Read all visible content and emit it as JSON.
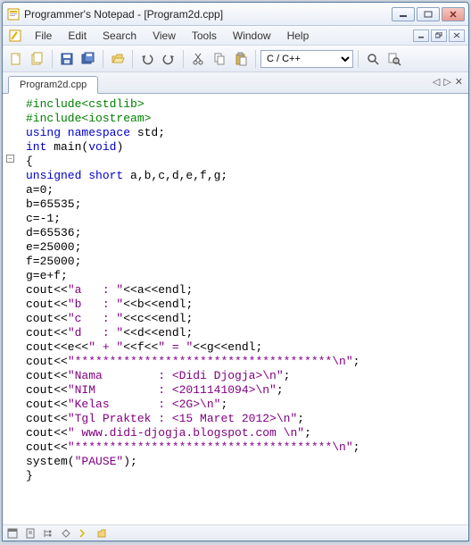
{
  "window": {
    "title": "Programmer's Notepad - [Program2d.cpp]"
  },
  "menu": {
    "file": "File",
    "edit": "Edit",
    "search": "Search",
    "view": "View",
    "tools": "Tools",
    "window": "Window",
    "help": "Help"
  },
  "toolbar": {
    "scheme_selected": "C / C++"
  },
  "tabs": {
    "active": "Program2d.cpp"
  },
  "code": {
    "lines": [
      {
        "t": "pp",
        "s": "#include<cstdlib>"
      },
      {
        "t": "pp",
        "s": "#include<iostream>"
      },
      {
        "t": "mix",
        "parts": [
          {
            "c": "kw",
            "s": "using namespace"
          },
          {
            "c": "",
            "s": " std;"
          }
        ]
      },
      {
        "t": "mix",
        "parts": [
          {
            "c": "kw",
            "s": "int"
          },
          {
            "c": "",
            "s": " main("
          },
          {
            "c": "kw",
            "s": "void"
          },
          {
            "c": "",
            "s": ")"
          }
        ]
      },
      {
        "t": "plain",
        "s": "{"
      },
      {
        "t": "mix",
        "parts": [
          {
            "c": "kw",
            "s": "unsigned short"
          },
          {
            "c": "",
            "s": " a,b,c,d,e,f,g;"
          }
        ]
      },
      {
        "t": "plain",
        "s": "a=0;"
      },
      {
        "t": "plain",
        "s": "b=65535;"
      },
      {
        "t": "plain",
        "s": "c=-1;"
      },
      {
        "t": "plain",
        "s": "d=65536;"
      },
      {
        "t": "plain",
        "s": "e=25000;"
      },
      {
        "t": "plain",
        "s": "f=25000;"
      },
      {
        "t": "plain",
        "s": "g=e+f;"
      },
      {
        "t": "mix",
        "parts": [
          {
            "c": "",
            "s": "cout<<"
          },
          {
            "c": "str",
            "s": "\"a   : \""
          },
          {
            "c": "",
            "s": "<<a<<endl;"
          }
        ]
      },
      {
        "t": "mix",
        "parts": [
          {
            "c": "",
            "s": "cout<<"
          },
          {
            "c": "str",
            "s": "\"b   : \""
          },
          {
            "c": "",
            "s": "<<b<<endl;"
          }
        ]
      },
      {
        "t": "mix",
        "parts": [
          {
            "c": "",
            "s": "cout<<"
          },
          {
            "c": "str",
            "s": "\"c   : \""
          },
          {
            "c": "",
            "s": "<<c<<endl;"
          }
        ]
      },
      {
        "t": "mix",
        "parts": [
          {
            "c": "",
            "s": "cout<<"
          },
          {
            "c": "str",
            "s": "\"d   : \""
          },
          {
            "c": "",
            "s": "<<d<<endl;"
          }
        ]
      },
      {
        "t": "mix",
        "parts": [
          {
            "c": "",
            "s": "cout<<e<<"
          },
          {
            "c": "str",
            "s": "\" + \""
          },
          {
            "c": "",
            "s": "<<f<<"
          },
          {
            "c": "str",
            "s": "\" = \""
          },
          {
            "c": "",
            "s": "<<g<<endl;"
          }
        ]
      },
      {
        "t": "mix",
        "parts": [
          {
            "c": "",
            "s": "cout<<"
          },
          {
            "c": "str",
            "s": "\"*************************************\\n\""
          },
          {
            "c": "",
            "s": ";"
          }
        ]
      },
      {
        "t": "mix",
        "parts": [
          {
            "c": "",
            "s": "cout<<"
          },
          {
            "c": "str",
            "s": "\"Nama        : <Didi Djogja>\\n\""
          },
          {
            "c": "",
            "s": ";"
          }
        ]
      },
      {
        "t": "mix",
        "parts": [
          {
            "c": "",
            "s": "cout<<"
          },
          {
            "c": "str",
            "s": "\"NIM         : <2011141094>\\n\""
          },
          {
            "c": "",
            "s": ";"
          }
        ]
      },
      {
        "t": "mix",
        "parts": [
          {
            "c": "",
            "s": "cout<<"
          },
          {
            "c": "str",
            "s": "\"Kelas       : <2G>\\n\""
          },
          {
            "c": "",
            "s": ";"
          }
        ]
      },
      {
        "t": "mix",
        "parts": [
          {
            "c": "",
            "s": "cout<<"
          },
          {
            "c": "str",
            "s": "\"Tgl Praktek : <15 Maret 2012>\\n\""
          },
          {
            "c": "",
            "s": ";"
          }
        ]
      },
      {
        "t": "mix",
        "parts": [
          {
            "c": "",
            "s": "cout<<"
          },
          {
            "c": "str",
            "s": "\" www.didi-djogja.blogspot.com \\n\""
          },
          {
            "c": "",
            "s": ";"
          }
        ]
      },
      {
        "t": "mix",
        "parts": [
          {
            "c": "",
            "s": "cout<<"
          },
          {
            "c": "str",
            "s": "\"*************************************\\n\""
          },
          {
            "c": "",
            "s": ";"
          }
        ]
      },
      {
        "t": "mix",
        "parts": [
          {
            "c": "",
            "s": "system("
          },
          {
            "c": "str",
            "s": "\"PAUSE\""
          },
          {
            "c": "",
            "s": ");"
          }
        ]
      },
      {
        "t": "plain",
        "s": "}"
      }
    ]
  },
  "tabnav": {
    "prev": "◁",
    "next": "▷",
    "close": "✕"
  }
}
